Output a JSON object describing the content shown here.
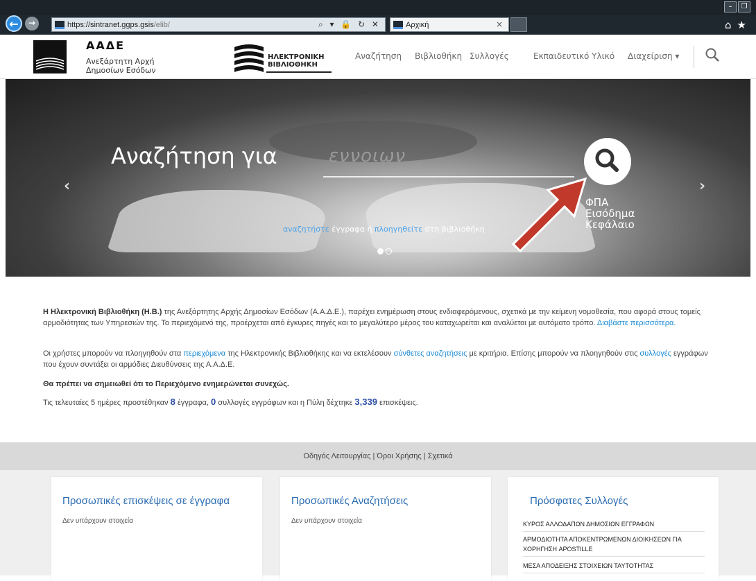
{
  "browser": {
    "url_host": "https://sintranet.ggps.gsis",
    "url_path": "/elib/",
    "addr_icons": "⌕ ▾ 🔒 ↻ ✕",
    "tab_title": "Αρχική",
    "tab_close": "×",
    "back_glyph": "←",
    "forward_glyph": "→",
    "toolbar_icons": "⌂★",
    "min_glyph": "–",
    "max_glyph": "❐"
  },
  "header": {
    "brand_title": "ΑΑΔΕ",
    "brand_sub1": "Ανεξάρτητη Αρχή",
    "brand_sub2": "Δημοσίων Εσόδων",
    "library_t1": "ΗΛΕΚΤΡΟΝΙΚΗ",
    "library_t2": "ΒΙΒΛΙΟΘΗΚΗ",
    "nav": [
      "Αναζήτηση",
      "Βιβλιοθήκη",
      "Συλλογές",
      "Εκπαιδευτικό Υλικό",
      "Διαχείριση ▾"
    ]
  },
  "hero": {
    "title": "Αναζήτηση για",
    "example": "εννοιων",
    "keywords": [
      "ΦΠΑ",
      "Εισόδημα",
      "Κεφάλαιο"
    ],
    "hint_link1": "αναζητήστε",
    "hint_mid": " έγγραφα ή ",
    "hint_link2": "πλοηγηθείτε",
    "hint_end": " στη βιβλιοθήκη",
    "prev": "‹",
    "next": "›"
  },
  "intro": {
    "p1_bold": "Η Ηλεκτρονική Βιβλιοθήκη (Η.Β.)",
    "p1_text": " της Ανεξάρτητης Αρχής Δημοσίων Εσόδων (Α.Α.Δ.Ε.), παρέχει ενημέρωση στους ενδιαφερόμενους, σχετικά με την κείμενη νομοθεσία, που αφορά στους τομείς αρμοδιότητας των Υπηρεσιών της. Το περιεχόμενό της, προέρχεται από έγκυρες πηγές και το μεγαλύτερο μέρος του καταχωρείται και αναλύεται με αυτόματο τρόπο. ",
    "p1_link": "Διαβάστε περισσότερα.",
    "p2_a": "Οι χρήστες μπορούν να πλοηγηθούν στα ",
    "p2_link1": "περιεχόμενα",
    "p2_b": " της Ηλεκτρονικής Βιβλιοθήκης και να εκτελέσουν ",
    "p2_link2": "σύνθετες αναζητήσεις",
    "p2_c": " με κριτήρια. Επίσης μπορούν να πλοηγηθούν στις ",
    "p2_link3": "συλλογές",
    "p2_d": " εγγράφων που έχουν συντάξει οι αρμόδιες Διευθύνσεις της Α.Α.Δ.Ε.",
    "p3_bold": "Θα πρέπει να σημειωθεί ότι το Περιεχόμενο ενημερώνεται συνεχώς.",
    "p4_a": "Τις τελευταίες 5 ημέρες προστέθηκαν ",
    "p4_n1": "8",
    "p4_b": " έγγραφα, ",
    "p4_n2": "0",
    "p4_c": " συλλογές εγγράφων και η Πύλη δέχτηκε ",
    "p4_n3": "3,339",
    "p4_d": " επισκέψεις."
  },
  "footer": {
    "links": "Οδηγός Λειτουργίας | Όροι Χρήσης | Σχετικά"
  },
  "panels": {
    "visits_title": "Προσωπικές επισκέψεις σε έγγραφα",
    "visits_empty": "Δεν υπάρχουν στοιχεία",
    "searches_title": "Προσωπικές Αναζητήσεις",
    "searches_empty": "Δεν υπάρχουν στοιχεία",
    "collections_title": "Πρόσφατες Συλλογές",
    "collections": [
      "ΚΥΡΟΣ ΑΛΛΟΔΑΠΩΝ ΔΗΜΟΣΙΩΝ ΕΓΓΡΑΦΩΝ",
      "ΑΡΜΟΔΙΟΤΗΤΑ ΑΠΟΚΕΝΤΡΩΜΕΝΩΝ ΔΙΟΙΚΗΣΕΩΝ ΓΙΑ ΧΟΡΗΓΗΣΗ APOSTILLE",
      "ΜΕΣΑ ΑΠΟΔΕΙΞΗΣ ΣΤΟΙΧΕΙΩΝ ΤΑΥΤΟΤΗΤΑΣ"
    ]
  }
}
